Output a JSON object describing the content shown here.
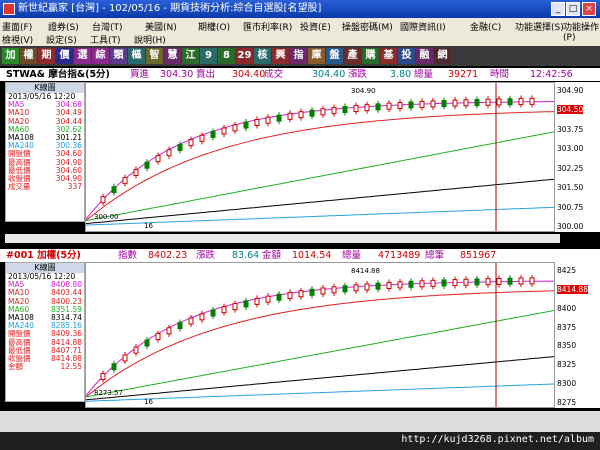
{
  "window": {
    "title": "新世紀贏家 [台灣] - 102/05/16 - 期貨技術分析:綜合自選股[名望股]"
  },
  "menu": {
    "row1": [
      "畫面(F)",
      "證券(S)",
      "台灣(T)",
      "美國(N)",
      "期權(O)",
      "匯市利率(R)",
      "投資(E)",
      "操盤密碼(M)",
      "國際資訊(I)",
      "金融(C)",
      "功能選擇(S)",
      "功能操作(P)"
    ],
    "row2": [
      "檢視(V)",
      "設定(S)",
      "工具(T)",
      "說明(H)"
    ]
  },
  "toolbar": {
    "buttons": [
      "加",
      "權",
      "期",
      "價",
      "選",
      "綜",
      "類",
      "樞",
      "智",
      "慧",
      "江",
      "9",
      "8",
      "29",
      "核",
      "興",
      "指",
      "庫",
      "盤",
      "產",
      "購",
      "基",
      "投",
      "融",
      "網"
    ]
  },
  "panel1": {
    "symbol": "STWA& 摩台指&(5分)",
    "bid_label": "買進",
    "bid": "304.30",
    "ask_label": "賣出",
    "ask": "304.40",
    "last_label": "成交",
    "last": "304.40",
    "chg_label": "漲跌",
    "chg": "3.80",
    "vol_label": "總量",
    "vol": "39271",
    "time_label": "時間",
    "time": "12:42:56",
    "sidebar": {
      "title": "K線圖",
      "date": "2013/05/16 12:20",
      "rows": [
        {
          "k": "MA5",
          "v": "304.68",
          "c": "#d020d0"
        },
        {
          "k": "MA10",
          "v": "304.49",
          "c": "#e02020"
        },
        {
          "k": "MA20",
          "v": "304.44",
          "c": "#e02020"
        },
        {
          "k": "MA60",
          "v": "302.62",
          "c": "#20b020"
        },
        {
          "k": "MA108",
          "v": "301.21",
          "c": "#000000"
        },
        {
          "k": "MA240",
          "v": "300.36",
          "c": "#20a0e0"
        },
        {
          "k": "開盤價",
          "v": "304.60",
          "c": "#e02020"
        },
        {
          "k": "最高價",
          "v": "304.90",
          "c": "#e02020"
        },
        {
          "k": "最低價",
          "v": "304.60",
          "c": "#e02020"
        },
        {
          "k": "收盤價",
          "v": "304.90",
          "c": "#e02020"
        },
        {
          "k": "成交量",
          "v": "337",
          "c": "#e02020"
        }
      ]
    },
    "yticks": [
      "304.90",
      "304.50",
      "303.75",
      "303.00",
      "302.25",
      "301.50",
      "300.75",
      "300.00"
    ],
    "high_label": "304.90",
    "low_label": "300.00",
    "x_label": "16"
  },
  "panel2": {
    "symbol": "#001 加權(5分)",
    "idx_label": "指數",
    "idx": "8402.23",
    "chg_label": "漲跌",
    "chg": "83.64",
    "amt_label": "金額",
    "amt": "1014.54",
    "vol_label": "總量",
    "vol": "4713489",
    "cnt_label": "總筆",
    "cnt": "851967",
    "sidebar": {
      "title": "K線圖",
      "date": "2013/05/16 12:20",
      "rows": [
        {
          "k": "MA5",
          "v": "8408.80",
          "c": "#d020d0"
        },
        {
          "k": "MA10",
          "v": "8403.44",
          "c": "#e02020"
        },
        {
          "k": "MA20",
          "v": "8400.23",
          "c": "#e02020"
        },
        {
          "k": "MA60",
          "v": "8351.59",
          "c": "#20b020"
        },
        {
          "k": "MA108",
          "v": "8314.74",
          "c": "#000000"
        },
        {
          "k": "MA240",
          "v": "8285.16",
          "c": "#20a0e0"
        },
        {
          "k": "開盤價",
          "v": "8409.36",
          "c": "#e02020"
        },
        {
          "k": "最高價",
          "v": "8414.88",
          "c": "#e02020"
        },
        {
          "k": "最低價",
          "v": "8407.71",
          "c": "#e02020"
        },
        {
          "k": "收盤價",
          "v": "8414.88",
          "c": "#e02020"
        },
        {
          "k": "金額",
          "v": "12.55",
          "c": "#e02020"
        }
      ]
    },
    "yticks": [
      "8425",
      "8414.88",
      "8400",
      "8375",
      "8350",
      "8325",
      "8300",
      "8275"
    ],
    "high_label": "8414.88",
    "low_label": "8273.57",
    "x_label": "16"
  },
  "status": {
    "url": "http://kujd3268.pixnet.net/album"
  }
}
